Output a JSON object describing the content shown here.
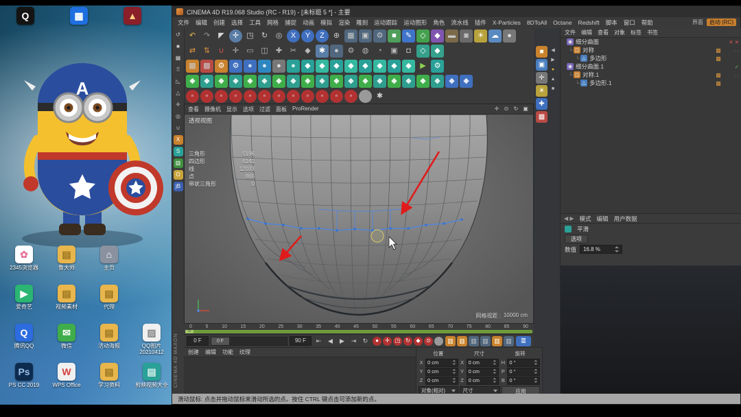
{
  "window": {
    "title": "CINEMA 4D R19.068 Studio (RC - R19) - [未标题 5 *] - 主要",
    "interface_label": "界面",
    "interface_value": "启动 (RC)"
  },
  "menu": {
    "items": [
      "文件",
      "编辑",
      "创建",
      "选择",
      "工具",
      "网格",
      "捕捉",
      "动画",
      "模拟",
      "渲染",
      "雕刻",
      "运动跟踪",
      "运动图形",
      "角色",
      "流水线",
      "插件",
      "X-Particles",
      "8DToAll",
      "Octane",
      "Redshift",
      "脚本",
      "窗口",
      "帮助"
    ]
  },
  "toolbars": {
    "row1": [
      {
        "g": "↶",
        "c": "#e2b94e"
      },
      {
        "g": "↷",
        "c": "#8f8f8f"
      },
      {
        "g": "◤",
        "c": "#d8d8d8"
      },
      {
        "g": "✛",
        "c": "#ffffff",
        "b": "#5a7da6",
        "cls": "round"
      },
      {
        "g": "◳",
        "c": "#d0d0d0"
      },
      {
        "g": "↻",
        "c": "#d0d0d0"
      },
      {
        "g": "◎",
        "c": "#d0d0d0"
      },
      {
        "g": "X",
        "b": "#3f6fbe",
        "c": "#fff",
        "cls": "round"
      },
      {
        "g": "Y",
        "b": "#3f6fbe",
        "c": "#fff",
        "cls": "round"
      },
      {
        "g": "Z",
        "b": "#3f6fbe",
        "c": "#fff",
        "cls": "round"
      },
      {
        "g": "⊕",
        "c": "#c8c8c8"
      },
      {
        "g": "▦",
        "b": "#50677e"
      },
      {
        "g": "▣",
        "b": "#50677e"
      },
      {
        "g": "⚙",
        "b": "#50677e"
      },
      {
        "g": "■",
        "b": "#4f9e5a",
        "c": "#fff"
      },
      {
        "g": "✎",
        "b": "#3f74c9",
        "c": "#fff"
      },
      {
        "g": "◇",
        "b": "#44a04e",
        "c": "#fff"
      },
      {
        "g": "◆",
        "b": "#8055b0",
        "c": "#fff"
      },
      {
        "g": "▬",
        "b": "#7a6a4a"
      },
      {
        "g": "◙",
        "b": "#6a6a6a"
      },
      {
        "g": "☀",
        "b": "#b8a23c",
        "c": "#fff"
      },
      {
        "g": "☁",
        "b": "#5a8bc0",
        "c": "#fff"
      },
      {
        "g": "●",
        "b": "#787878",
        "c": "#ddd"
      }
    ],
    "row2": [
      {
        "g": "⇄",
        "c": "#e0953f"
      },
      {
        "g": "⇅",
        "c": "#e0953f"
      },
      {
        "g": "∪",
        "c": "#d35450"
      },
      {
        "g": "✛",
        "c": "#b8b8b8"
      },
      {
        "g": "▭",
        "c": "#b8b8b8"
      },
      {
        "g": "◫",
        "c": "#b8b8b8"
      },
      {
        "g": "✚",
        "c": "#b8b8b8"
      },
      {
        "g": "✂",
        "c": "#b8b8b8"
      },
      {
        "g": "◆",
        "c": "#b8b8b8"
      },
      {
        "g": "✱",
        "c": "#ffffff",
        "b": "#5a7da6"
      },
      {
        "g": "●",
        "b": "#50677e"
      },
      {
        "g": "⚙",
        "c": "#b8b8b8"
      },
      {
        "g": "◍",
        "c": "#b8b8b8"
      },
      {
        "g": "◔",
        "c": "#b8b8b8"
      },
      {
        "g": "▣",
        "c": "#b8b8b8"
      },
      {
        "g": "◘",
        "c": "#b8b8b8"
      },
      {
        "g": "◇",
        "b": "#35a08c",
        "c": "#fff"
      },
      {
        "g": "◆",
        "b": "#35a08c",
        "c": "#fff"
      }
    ],
    "row3": [
      {
        "g": "▩",
        "b": "#c9822e"
      },
      {
        "g": "▩",
        "b": "#b84a44"
      },
      {
        "g": "⚙",
        "b": "#c9822e",
        "c": "#fff"
      },
      {
        "g": "⚙",
        "b": "#3f6fbe",
        "c": "#fff"
      },
      {
        "g": "●",
        "b": "#3f6fbe",
        "c": "#cfe0f5"
      },
      {
        "g": "●",
        "b": "#2e86c1",
        "c": "#d8ecf8"
      },
      {
        "g": "●",
        "b": "#787878",
        "c": "#ddd"
      },
      {
        "g": "●",
        "b": "#2aa198",
        "c": "#d8f0ec"
      },
      {
        "g": "◆",
        "b": "#2aa198",
        "c": "#fff"
      },
      {
        "g": "◆",
        "b": "#35b8a0",
        "c": "#fff"
      },
      {
        "g": "◆",
        "b": "#2aa198",
        "c": "#fff"
      },
      {
        "g": "◆",
        "b": "#35b8a0",
        "c": "#fff"
      },
      {
        "g": "◆",
        "b": "#2aa198",
        "c": "#fff"
      },
      {
        "g": "◆",
        "b": "#35b8a0",
        "c": "#fff"
      },
      {
        "g": "◆",
        "b": "#2aa198",
        "c": "#fff"
      },
      {
        "g": "◆",
        "b": "#35b8a0",
        "c": "#fff"
      },
      {
        "g": "▶",
        "c": "#8fd14f"
      },
      {
        "g": "⚙",
        "b": "#2aa198",
        "c": "#fff"
      }
    ],
    "row4": [
      {
        "g": "◆",
        "b": "#3fae4a",
        "c": "#eaf6ea"
      },
      {
        "g": "◆",
        "b": "#2e9e8e",
        "c": "#e2f2ef"
      },
      {
        "g": "◆",
        "b": "#3fae4a",
        "c": "#eaf6ea"
      },
      {
        "g": "◆",
        "b": "#2e9e8e",
        "c": "#e2f2ef"
      },
      {
        "g": "◆",
        "b": "#3fae4a",
        "c": "#eaf6ea"
      },
      {
        "g": "◆",
        "b": "#2e9e8e",
        "c": "#e2f2ef"
      },
      {
        "g": "◆",
        "b": "#3fae4a",
        "c": "#eaf6ea"
      },
      {
        "g": "◆",
        "b": "#2e9e8e",
        "c": "#e2f2ef"
      },
      {
        "g": "◆",
        "b": "#3fae4a",
        "c": "#eaf6ea"
      },
      {
        "g": "◆",
        "b": "#2e9e8e",
        "c": "#e2f2ef"
      },
      {
        "g": "◆",
        "b": "#3fae4a",
        "c": "#eaf6ea"
      },
      {
        "g": "◆",
        "b": "#2e9e8e",
        "c": "#e2f2ef"
      },
      {
        "g": "◆",
        "b": "#3fae4a",
        "c": "#eaf6ea"
      },
      {
        "g": "◆",
        "b": "#2e9e8e",
        "c": "#e2f2ef"
      },
      {
        "g": "◆",
        "b": "#3fae4a",
        "c": "#eaf6ea"
      },
      {
        "g": "◆",
        "b": "#2e9e8e",
        "c": "#e2f2ef"
      },
      {
        "g": "◆",
        "b": "#3fae4a",
        "c": "#eaf6ea"
      },
      {
        "g": "◆",
        "b": "#2e9e8e",
        "c": "#e2f2ef"
      },
      {
        "g": "◆",
        "b": "#3f6fbe",
        "c": "#e2eaf6"
      },
      {
        "g": "◆",
        "b": "#3f6fbe",
        "c": "#e2eaf6"
      }
    ],
    "row5": [
      {
        "g": "◦",
        "b": "#b23232",
        "c": "#fff",
        "cls": "round"
      },
      {
        "g": "◦",
        "b": "#b23232",
        "c": "#fff",
        "cls": "round"
      },
      {
        "g": "◦",
        "b": "#b23232",
        "c": "#fff",
        "cls": "round"
      },
      {
        "g": "◦",
        "b": "#b23232",
        "c": "#fff",
        "cls": "round"
      },
      {
        "g": "◦",
        "b": "#b23232",
        "c": "#fff",
        "cls": "round"
      },
      {
        "g": "◦",
        "b": "#b23232",
        "c": "#fff",
        "cls": "round"
      },
      {
        "g": "◦",
        "b": "#b23232",
        "c": "#fff",
        "cls": "round"
      },
      {
        "g": "◦",
        "b": "#b23232",
        "c": "#fff",
        "cls": "round"
      },
      {
        "g": "◦",
        "b": "#b23232",
        "c": "#fff",
        "cls": "round"
      },
      {
        "g": "◦",
        "b": "#b23232",
        "c": "#fff",
        "cls": "round"
      },
      {
        "g": "◦",
        "b": "#b23232",
        "c": "#fff",
        "cls": "round"
      },
      {
        "g": "◦",
        "b": "#b23232",
        "c": "#fff",
        "cls": "round"
      },
      {
        "g": "",
        "b": "#9a9a9a",
        "cls": "round"
      },
      {
        "g": "✱",
        "c": "#cfcfcf"
      }
    ]
  },
  "left_toolbar": {
    "items": [
      {
        "g": "↺",
        "c": "#c8c8c8"
      },
      {
        "g": "■",
        "c": "#c8c8c8"
      },
      {
        "g": "▦",
        "c": "#c8c8c8"
      },
      {
        "g": "⠿",
        "c": "#c8c8c8"
      },
      {
        "g": "◺",
        "c": "#c8c8c8"
      },
      {
        "g": "△",
        "c": "#c8c8c8"
      },
      {
        "g": "✛",
        "c": "#c8c8c8"
      },
      {
        "g": "◎",
        "c": "#c8c8c8"
      },
      {
        "g": "∪",
        "c": "#c8c8c8"
      },
      {
        "g": "X",
        "b": "#c9822e",
        "c": "#fff"
      },
      {
        "g": "S",
        "b": "#2aa198",
        "c": "#fff"
      },
      {
        "g": "▥",
        "b": "#3f8f3f",
        "c": "#fff"
      },
      {
        "g": "O",
        "b": "#caa53c",
        "c": "#fff"
      },
      {
        "g": "jB",
        "b": "#3a5fae",
        "c": "#fff"
      }
    ]
  },
  "right_palette": {
    "main": [
      {
        "g": "■",
        "b": "#c9822e",
        "c": "#ffe"
      },
      {
        "g": "▣",
        "b": "#4a7fbf",
        "c": "#fff"
      },
      {
        "g": "✛",
        "b": "#787878",
        "c": "#eee"
      },
      {
        "g": "☀",
        "b": "#b8a23c",
        "c": "#fff"
      },
      {
        "g": "✚",
        "b": "#3f6fbe",
        "c": "#fff"
      },
      {
        "g": "▩",
        "b": "#b84a44",
        "c": "#fff"
      }
    ],
    "small": [
      {
        "g": "◀",
        "c": "#b8b8b8"
      },
      {
        "g": "▶",
        "c": "#b8b8b8"
      },
      {
        "g": "●",
        "c": "#d3b33f"
      },
      {
        "g": "▲",
        "c": "#b8b8b8"
      },
      {
        "g": "■",
        "c": "#b8b8b8"
      }
    ]
  },
  "viewport": {
    "menus": [
      "查看",
      "摄像机",
      "显示",
      "选项",
      "过滤",
      "面板",
      "ProRender"
    ],
    "controls": [
      {
        "g": "✛"
      },
      {
        "g": "⊙"
      },
      {
        "g": "↻"
      },
      {
        "g": "▣"
      }
    ],
    "view_label": "透视视图",
    "stats": [
      {
        "l": "三角形",
        "v": "5196"
      },
      {
        "l": "四边形",
        "v": "6141"
      },
      {
        "l": "线",
        "v": "12033"
      },
      {
        "l": "点",
        "v": "866"
      },
      {
        "l": "带状三角形",
        "v": "0"
      }
    ],
    "grid_label": "网格视距 :",
    "grid_value": "10000 cm"
  },
  "object_manager": {
    "menus": [
      "文件",
      "编辑",
      "查看",
      "对象",
      "标签",
      "书签"
    ],
    "items": [
      {
        "depth": 0,
        "branch": "",
        "label": "细分曲面",
        "iconG": "◉",
        "iconB": "#7a68b8",
        "vis": "✕ ✕",
        "visC": "#e05555",
        "tag": "",
        "tagC": ""
      },
      {
        "depth": 1,
        "branch": "└",
        "label": "对称",
        "iconG": "◫",
        "iconB": "#c77f2e",
        "vis": "· ·",
        "visC": "#9a9a9a",
        "tag": "▩",
        "tagC": "#d9953d"
      },
      {
        "depth": 2,
        "branch": "└",
        "label": "多边形",
        "iconG": "△",
        "iconB": "#4a7fbf",
        "vis": "",
        "visC": "",
        "tag": "▩",
        "tagC": "#d9953d"
      },
      {
        "depth": 0,
        "branch": "",
        "label": "细分曲面.1",
        "iconG": "◉",
        "iconB": "#7a68b8",
        "vis": "✓",
        "visC": "#6cc36c",
        "tag": "",
        "tagC": ""
      },
      {
        "depth": 1,
        "branch": "└",
        "label": "对称.1",
        "iconG": "◫",
        "iconB": "#c77f2e",
        "vis": "· ·",
        "visC": "#9a9a9a",
        "tag": "▩",
        "tagC": "#d9953d"
      },
      {
        "depth": 2,
        "branch": "└",
        "label": "多边形.1",
        "iconG": "△",
        "iconB": "#4a7fbf",
        "vis": "",
        "visC": "",
        "tag": "▩",
        "tagC": "#d9953d"
      }
    ]
  },
  "attributes": {
    "nav": "◀ ▶",
    "menus": [
      "模式",
      "编辑",
      "用户数据"
    ],
    "title": "平滑",
    "tab": "选项",
    "param": "数值",
    "value": "16.8 %"
  },
  "timeline": {
    "ticks": [
      "0",
      "5",
      "10",
      "15",
      "20",
      "25",
      "30",
      "35",
      "40",
      "45",
      "50",
      "55",
      "60",
      "65",
      "70",
      "75",
      "80",
      "85",
      "90"
    ],
    "marker": "0",
    "handle": "0 F",
    "start": "0 F",
    "end": "90 F",
    "buttons": [
      {
        "g": "⇤"
      },
      {
        "g": "◀"
      },
      {
        "g": "▶"
      },
      {
        "g": "⇥"
      },
      {
        "g": "↻"
      }
    ],
    "record": [
      {
        "g": "●",
        "b": "#b23232",
        "c": "#fff",
        "cls": "round"
      },
      {
        "g": "✛",
        "b": "#b23232",
        "c": "#fff",
        "cls": "round"
      },
      {
        "g": "◳",
        "b": "#b23232",
        "c": "#fff",
        "cls": "round"
      },
      {
        "g": "↻",
        "b": "#b23232",
        "c": "#fff",
        "cls": "round"
      },
      {
        "g": "◆",
        "b": "#b23232",
        "c": "#fff",
        "cls": "round"
      },
      {
        "g": "⊙",
        "b": "#b23232",
        "c": "#fff",
        "cls": "round"
      },
      {
        "g": "",
        "b": "#9a9a9a",
        "cls": "round"
      }
    ],
    "extras": [
      {
        "g": "▥",
        "b": "#c9822e",
        "c": "#ffe"
      },
      {
        "g": "▥",
        "b": "#c9822e",
        "c": "#ffe"
      },
      {
        "g": "▥",
        "b": "#50677e"
      },
      {
        "g": "▥",
        "b": "#50677e"
      },
      {
        "g": "▥",
        "b": "#c9822e",
        "c": "#ffe"
      },
      {
        "g": "▥",
        "b": "#50677e"
      }
    ],
    "panel_glyph": "≣"
  },
  "materials": {
    "menus": [
      "创建",
      "编辑",
      "功能",
      "纹理"
    ]
  },
  "coords": {
    "h_pos": "位置",
    "h_size": "尺寸",
    "h_rot": "旋转",
    "rows": [
      {
        "a": "X",
        "pos": "0 cm",
        "b": "X",
        "size": "0 cm",
        "c": "H",
        "rot": "0 °"
      },
      {
        "a": "Y",
        "pos": "0 cm",
        "b": "Y",
        "size": "0 cm",
        "c": "P",
        "rot": "0 °"
      },
      {
        "a": "Z",
        "pos": "0 cm",
        "b": "Z",
        "size": "0 cm",
        "c": "B",
        "rot": "0 °"
      }
    ],
    "mode": "对象(相对)",
    "size_mode": "尺寸",
    "apply": "应用"
  },
  "branding": {
    "line1": "MAXON",
    "line2": "CINEMA 4D"
  },
  "statusbar": {
    "text": "滑动鼠标: 点击并拖动鼠标来滑动所选的点。按住 CTRL 键点击可添加新的点。"
  },
  "desktop": {
    "wallpaper_letter": "A",
    "top_icons": [
      {
        "g": "Q",
        "b": "#141414",
        "c": "#fff",
        "label": ""
      },
      {
        "g": "▦",
        "b": "#1f6fe0",
        "c": "#fff",
        "label": ""
      },
      {
        "g": "▲",
        "b": "#8a1f2a",
        "c": "#ffd27f",
        "label": ""
      }
    ],
    "icons": [
      {
        "g": "✿",
        "b": "#ffffff",
        "c": "#e8739b",
        "label": "2345浏览器"
      },
      {
        "g": "▤",
        "b": "#e8b64c",
        "c": "#9a7520",
        "label": "鲁大师"
      },
      {
        "g": "⌂",
        "b": "#8a92a0",
        "c": "#ffffff",
        "label": "主页"
      },
      {
        "cls": "sp",
        "g": "",
        "label": ""
      },
      {
        "g": "▶",
        "b": "#2bb673",
        "c": "#ffffff",
        "label": "爱奇艺"
      },
      {
        "g": "▤",
        "b": "#e8b64c",
        "c": "#9a7520",
        "label": "视频素材"
      },
      {
        "g": "▤",
        "b": "#e8b64c",
        "c": "#9a7520",
        "label": "代理"
      },
      {
        "cls": "sp",
        "g": "",
        "label": ""
      },
      {
        "g": "Q",
        "b": "#2d6cdf",
        "c": "#ffffff",
        "label": "腾讯QQ"
      },
      {
        "g": "✉",
        "b": "#3fae4a",
        "c": "#ffffff",
        "label": "微信"
      },
      {
        "g": "▤",
        "b": "#e8b64c",
        "c": "#9a7520",
        "label": "活动海报"
      },
      {
        "g": "▨",
        "b": "#f0f0f0",
        "c": "#888888",
        "label": "QQ图片20210412"
      },
      {
        "g": "Ps",
        "b": "#0d2b4e",
        "c": "#9cc3e8",
        "label": "PS CC 2019"
      },
      {
        "g": "W",
        "b": "#f0f0f0",
        "c": "#d34040",
        "label": "WPS Office"
      },
      {
        "g": "▤",
        "b": "#e8b64c",
        "c": "#9a7520",
        "label": "学习资料"
      },
      {
        "g": "▤",
        "b": "#2aa198",
        "c": "#d8f0ec",
        "label": "剪映视频大全"
      }
    ]
  }
}
